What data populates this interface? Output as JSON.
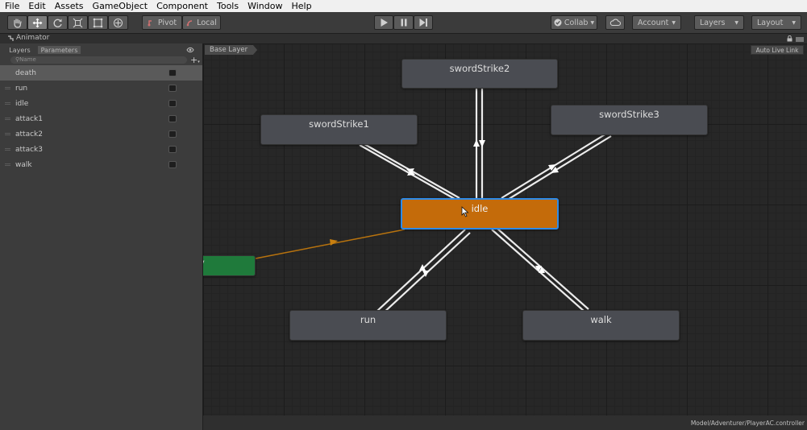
{
  "menubar": {
    "items": [
      "File",
      "Edit",
      "Assets",
      "GameObject",
      "Component",
      "Tools",
      "Window",
      "Help"
    ]
  },
  "toolbar": {
    "transform_tools": [
      "hand-tool-icon",
      "move-tool-icon",
      "rotate-tool-icon",
      "scale-tool-icon",
      "rect-tool-icon",
      "transform-tool-icon"
    ],
    "pivot_label": "Pivot",
    "local_label": "Local",
    "collab_label": "Collab",
    "account_label": "Account",
    "layers_label": "Layers",
    "layout_label": "Layout"
  },
  "animator": {
    "title": "Animator",
    "tabs": [
      "Layers",
      "Parameters"
    ],
    "search_placeholder": "Name",
    "parameters": [
      "death",
      "run",
      "idle",
      "attack1",
      "attack2",
      "attack3",
      "walk"
    ],
    "selected_parameter": "death",
    "breadcrumb": "Base Layer",
    "live_link_label": "Auto Live Link",
    "states": {
      "swordStrike2": "swordStrike2",
      "swordStrike1": "swordStrike1",
      "swordStrike3": "swordStrike3",
      "idle": "idle",
      "run": "run",
      "walk": "walk",
      "entry": "y"
    },
    "default_state": "idle",
    "default_state_color": "#c46b0a",
    "entry_color": "#1f7a3b",
    "state_color": "#4a4c52",
    "controller_path": "Model/Adventurer/PlayerAC.controller"
  }
}
